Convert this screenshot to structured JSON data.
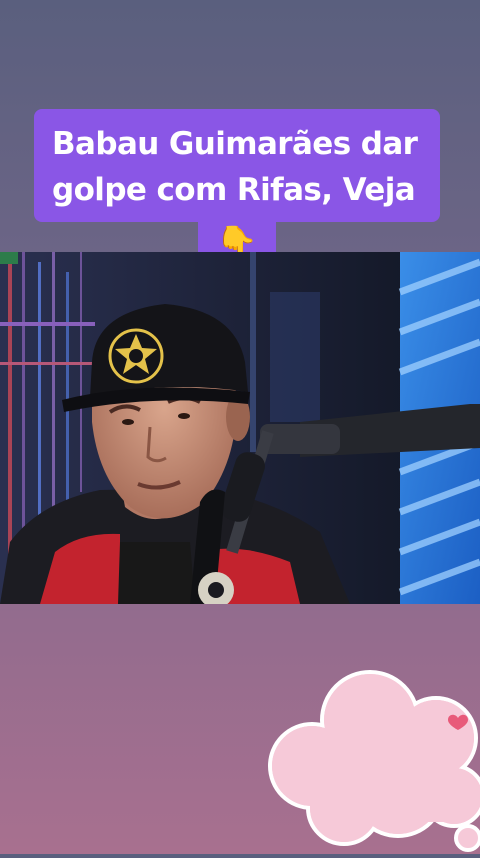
{
  "caption": {
    "line1": "Babau Guimarães dar",
    "line2": "golpe com Rifas, Veja",
    "emoji": "👇",
    "background_color": "#8a56e6",
    "text_color": "#ffffff"
  },
  "video": {
    "subject": "man wearing black cap with gold sheriff star speaking into microphone",
    "icon": "video-frame"
  },
  "decoration": {
    "icon": "thought-cloud-icon",
    "cloud_color": "#f6c9d8",
    "heart_color": "#e85a7a"
  }
}
